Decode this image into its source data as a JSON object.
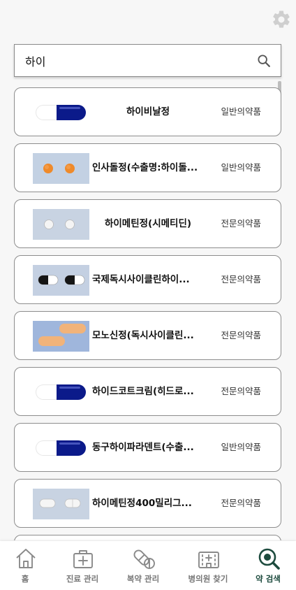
{
  "search": {
    "value": "하이",
    "placeholder": ""
  },
  "drugs": [
    {
      "name": "하이비날정",
      "category": "일반의약품",
      "image": "capsule-navy-white"
    },
    {
      "name": "인사돌정(수출명:하이돌...",
      "category": "일반의약품",
      "image": "orange-round-tablets"
    },
    {
      "name": "하이메틴정(시메티딘)",
      "category": "전문의약품",
      "image": "white-round-tablets"
    },
    {
      "name": "국제독시사이클린하이...",
      "category": "전문의약품",
      "image": "black-white-capsules"
    },
    {
      "name": "모노신정(독시사이클린...",
      "category": "전문의약품",
      "image": "orange-oblong-tablets"
    },
    {
      "name": "하이드코트크림(히드로...",
      "category": "전문의약품",
      "image": "capsule-navy-white"
    },
    {
      "name": "동구하이파라덴트(수출...",
      "category": "일반의약품",
      "image": "capsule-navy-white"
    },
    {
      "name": "하이메틴정400밀리그...",
      "category": "전문의약품",
      "image": "white-oblong-tablets"
    }
  ],
  "nav": [
    {
      "label": "홈",
      "icon": "home-icon",
      "active": false
    },
    {
      "label": "진료 관리",
      "icon": "medical-kit-icon",
      "active": false
    },
    {
      "label": "복약 관리",
      "icon": "pills-icon",
      "active": false
    },
    {
      "label": "병의원 찾기",
      "icon": "hospital-icon",
      "active": false
    },
    {
      "label": "약 검색",
      "icon": "search-pill-icon",
      "active": true
    }
  ],
  "colors": {
    "accent": "#1d4b3e",
    "inactive": "#8a8a8a",
    "capsule_navy": "#0b1a8a"
  }
}
